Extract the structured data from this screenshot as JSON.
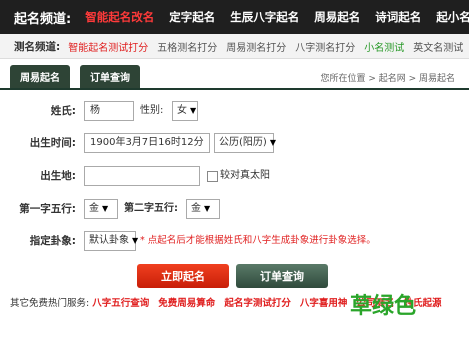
{
  "topnav": {
    "channel": "起名频道:",
    "items": [
      "智能起名改名",
      "定字起名",
      "生辰八字起名",
      "周易起名",
      "诗词起名",
      "起小名乳名"
    ]
  },
  "subnav": {
    "label": "测名频道:",
    "items": [
      "智能起名测试打分",
      "五格测名打分",
      "周易测名打分",
      "八字测名打分",
      "小名测试",
      "英文名测试",
      "其"
    ]
  },
  "tabs": [
    "周易起名",
    "订单查询"
  ],
  "breadcrumb": "您所在位置 > 起名网 > 周易起名",
  "form": {
    "surname_label": "姓氏:",
    "surname_value": "杨",
    "gender_label": "性别:",
    "gender_value": "女",
    "birth_label": "出生时间:",
    "birth_value": "1900年3月7日16时12分",
    "calendar_value": "公历(阳历)",
    "place_label": "出生地:",
    "place_value": "",
    "solar_label": "较对真太阳",
    "first_char_label": "第一字五行:",
    "first_char_value": "金",
    "second_char_label": "第二字五行:",
    "second_char_value": "金",
    "gua_label": "指定卦象:",
    "gua_value": "默认卦象",
    "gua_tip": "* 点起名后才能根据姓氏和八字生成卦象进行卦象选择。"
  },
  "buttons": {
    "start": "立即起名",
    "order": "订单查询"
  },
  "footer": {
    "prefix": "其它免费热门服务:",
    "links": [
      "八字五行查询",
      "免费周易算命",
      "起名字测试打分",
      "八字喜用神",
      "公司测名",
      "姓氏起源"
    ]
  },
  "watermark": "草绿色"
}
